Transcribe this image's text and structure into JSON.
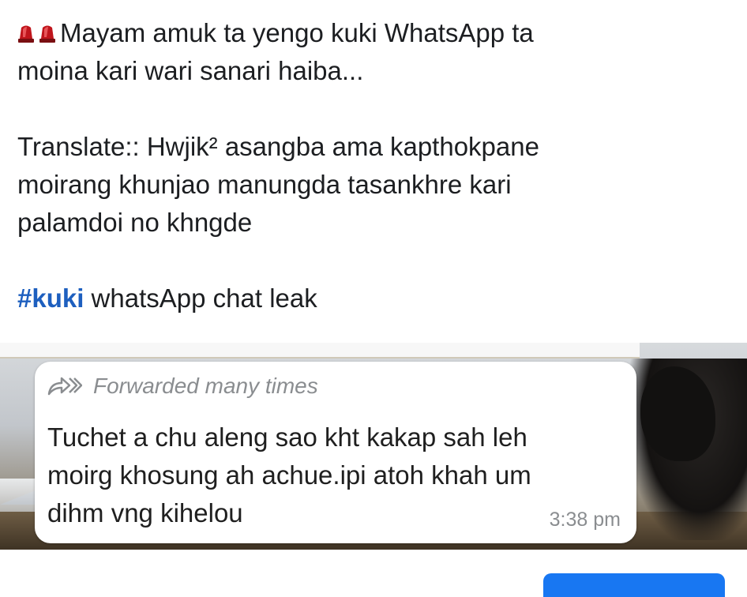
{
  "post": {
    "line1": "Mayam amuk ta yengo kuki WhatsApp ta",
    "line2": "moina kari wari sanari haiba...",
    "translate_line1": "Translate:: Hwjik² asangba ama kapthokpane",
    "translate_line2": "moirang khunjao manungda tasankhre kari",
    "translate_line3": "palamdoi no khngde",
    "hashtag": "#kuki",
    "hashtag_rest": " whatsApp chat leak",
    "icons": [
      "siren-icon",
      "siren-icon"
    ]
  },
  "image": {
    "forwarded_label": "Forwarded many times",
    "message_line1": "Tuchet a chu aleng sao kht kakap sah leh",
    "message_line2": "moirg khosung ah achue.ipi atoh khah um",
    "message_line3": "dihm vng kihelou",
    "time": "3:38 pm"
  },
  "colors": {
    "hashtag": "#1d5fbf",
    "siren": "#c0151c",
    "facebook_blue": "#1877f2"
  }
}
